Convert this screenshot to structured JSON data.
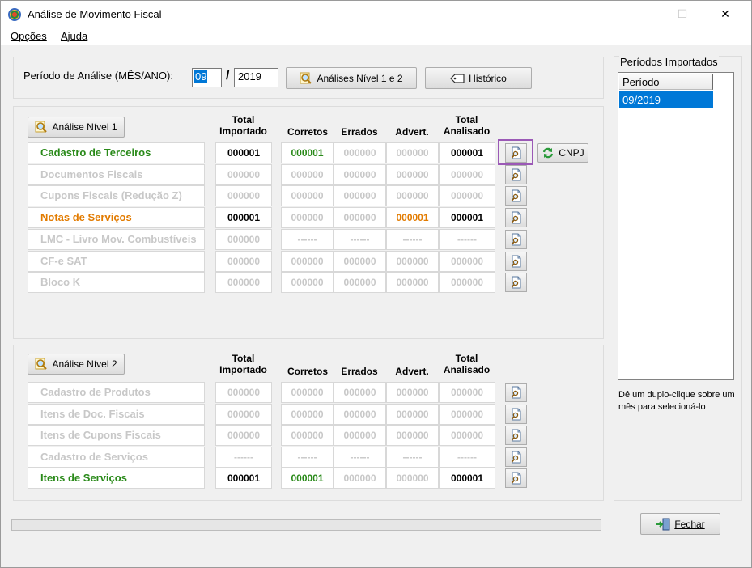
{
  "window": {
    "title": "Análise de Movimento Fiscal",
    "minimize": "—",
    "maximize": "☐",
    "close": "✕"
  },
  "menu": {
    "opcoes": "Opções",
    "ajuda": "Ajuda"
  },
  "period": {
    "label": "Período de Análise (MÊS/ANO):",
    "month": "09",
    "separator": "/",
    "year": "2019"
  },
  "toolbar": {
    "analises_label": "Análises Nível 1 e 2",
    "historico_label": "Histórico"
  },
  "headers": {
    "total_importado": "Total\nImportado",
    "corretos": "Corretos",
    "errados": "Errados",
    "advert": "Advert.",
    "total_analisado": "Total\nAnalisado"
  },
  "level1": {
    "button": "Análise Nível 1",
    "cnpj_button": "CNPJ",
    "rows": [
      {
        "label": "Cadastro de Terceiros",
        "total": "000001",
        "corretos": "000001",
        "errados": "000000",
        "advert": "000000",
        "analisado": "000001"
      },
      {
        "label": "Documentos Fiscais",
        "total": "000000",
        "corretos": "000000",
        "errados": "000000",
        "advert": "000000",
        "analisado": "000000"
      },
      {
        "label": "Cupons Fiscais (Redução Z)",
        "total": "000000",
        "corretos": "000000",
        "errados": "000000",
        "advert": "000000",
        "analisado": "000000"
      },
      {
        "label": "Notas de Serviços",
        "total": "000001",
        "corretos": "000000",
        "errados": "000000",
        "advert": "000001",
        "analisado": "000001"
      },
      {
        "label": "LMC - Livro Mov. Combustíveis",
        "total": "000000",
        "corretos": "------",
        "errados": "------",
        "advert": "------",
        "analisado": "------"
      },
      {
        "label": "CF-e SAT",
        "total": "000000",
        "corretos": "000000",
        "errados": "000000",
        "advert": "000000",
        "analisado": "000000"
      },
      {
        "label": "Bloco K",
        "total": "000000",
        "corretos": "000000",
        "errados": "000000",
        "advert": "000000",
        "analisado": "000000"
      }
    ]
  },
  "level2": {
    "button": "Análise Nível 2",
    "rows": [
      {
        "label": "Cadastro de Produtos",
        "total": "000000",
        "corretos": "000000",
        "errados": "000000",
        "advert": "000000",
        "analisado": "000000"
      },
      {
        "label": "Itens de Doc. Fiscais",
        "total": "000000",
        "corretos": "000000",
        "errados": "000000",
        "advert": "000000",
        "analisado": "000000"
      },
      {
        "label": "Itens de Cupons Fiscais",
        "total": "000000",
        "corretos": "000000",
        "errados": "000000",
        "advert": "000000",
        "analisado": "000000"
      },
      {
        "label": "Cadastro de Serviços",
        "total": "------",
        "corretos": "------",
        "errados": "------",
        "advert": "------",
        "analisado": "------"
      },
      {
        "label": "Itens de Serviços",
        "total": "000001",
        "corretos": "000001",
        "errados": "000000",
        "advert": "000000",
        "analisado": "000001"
      }
    ]
  },
  "periods": {
    "title": "Períodos Importados",
    "column": "Período",
    "items": [
      "09/2019"
    ],
    "hint": "Dê um duplo-clique sobre um mês para selecioná-lo"
  },
  "footer": {
    "fechar_label": "Fechar"
  },
  "colors": {
    "green": "#2a8a1a",
    "orange": "#e27b00",
    "disabled": "#c8c8c8",
    "selection": "#0078d7",
    "highlight": "#9b59b6"
  }
}
